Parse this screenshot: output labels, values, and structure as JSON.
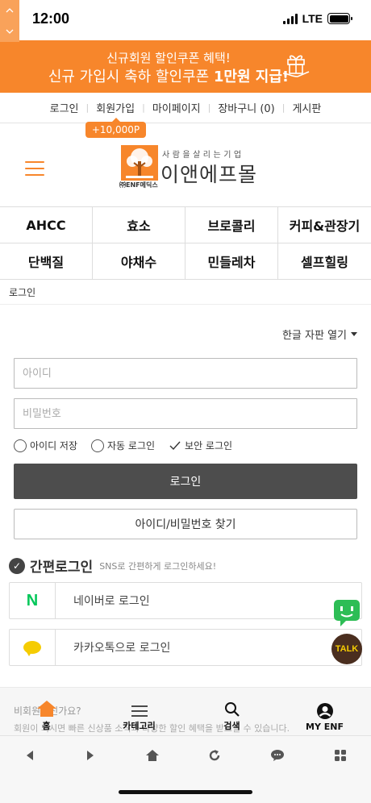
{
  "status": {
    "time": "12:00",
    "network": "LTE"
  },
  "banner": {
    "line1": "신규회원 할인쿠폰 혜택!",
    "line2_pre": "신규 가입시 축하 할인쿠폰 ",
    "line2_bold": "1만원 지급!",
    "bg_color": "#f7862b",
    "icon": "gift-icon"
  },
  "topmenu": {
    "items": [
      "로그인",
      "회원가입",
      "마이페이지",
      "장바구니 (0)",
      "게시판"
    ],
    "point_badge": "+10,000P"
  },
  "logo": {
    "slogan": "사람을살리는기업",
    "name": "이앤에프몰",
    "sub": "㈜ENF메딕스"
  },
  "categories": [
    "AHCC",
    "효소",
    "브로콜리",
    "커피&관장기",
    "단백질",
    "야채수",
    "민들레차",
    "셀프힐링"
  ],
  "breadcrumb": "로그인",
  "login": {
    "keyboard_link": "한글 자판 열기",
    "id_placeholder": "아이디",
    "pw_placeholder": "비밀번호",
    "save_id": "아이디 저장",
    "auto_login": "자동 로그인",
    "secure_login": "보안 로그인",
    "login_button": "로그인",
    "find_button": "아이디/비밀번호 찾기"
  },
  "easy_login": {
    "title": "간편로그인",
    "subtitle": "SNS로 간편하게 로그인하세요!",
    "naver": "네이버로 로그인",
    "kakao": "카카오톡으로 로그인"
  },
  "floating": {
    "talk": "TALK"
  },
  "guest": {
    "question": "비회원이신가요?",
    "desc": "회원이 되시면 빠른 신상품 소식과 다양한 할인 혜택을 받으실 수 있습니다."
  },
  "tabbar": [
    "홈",
    "카테고리",
    "검색",
    "MY ENF"
  ],
  "colors": {
    "accent": "#f7862b",
    "naver": "#03c75a",
    "kakao": "#f5cc02",
    "login_button": "#4d4d4d"
  }
}
